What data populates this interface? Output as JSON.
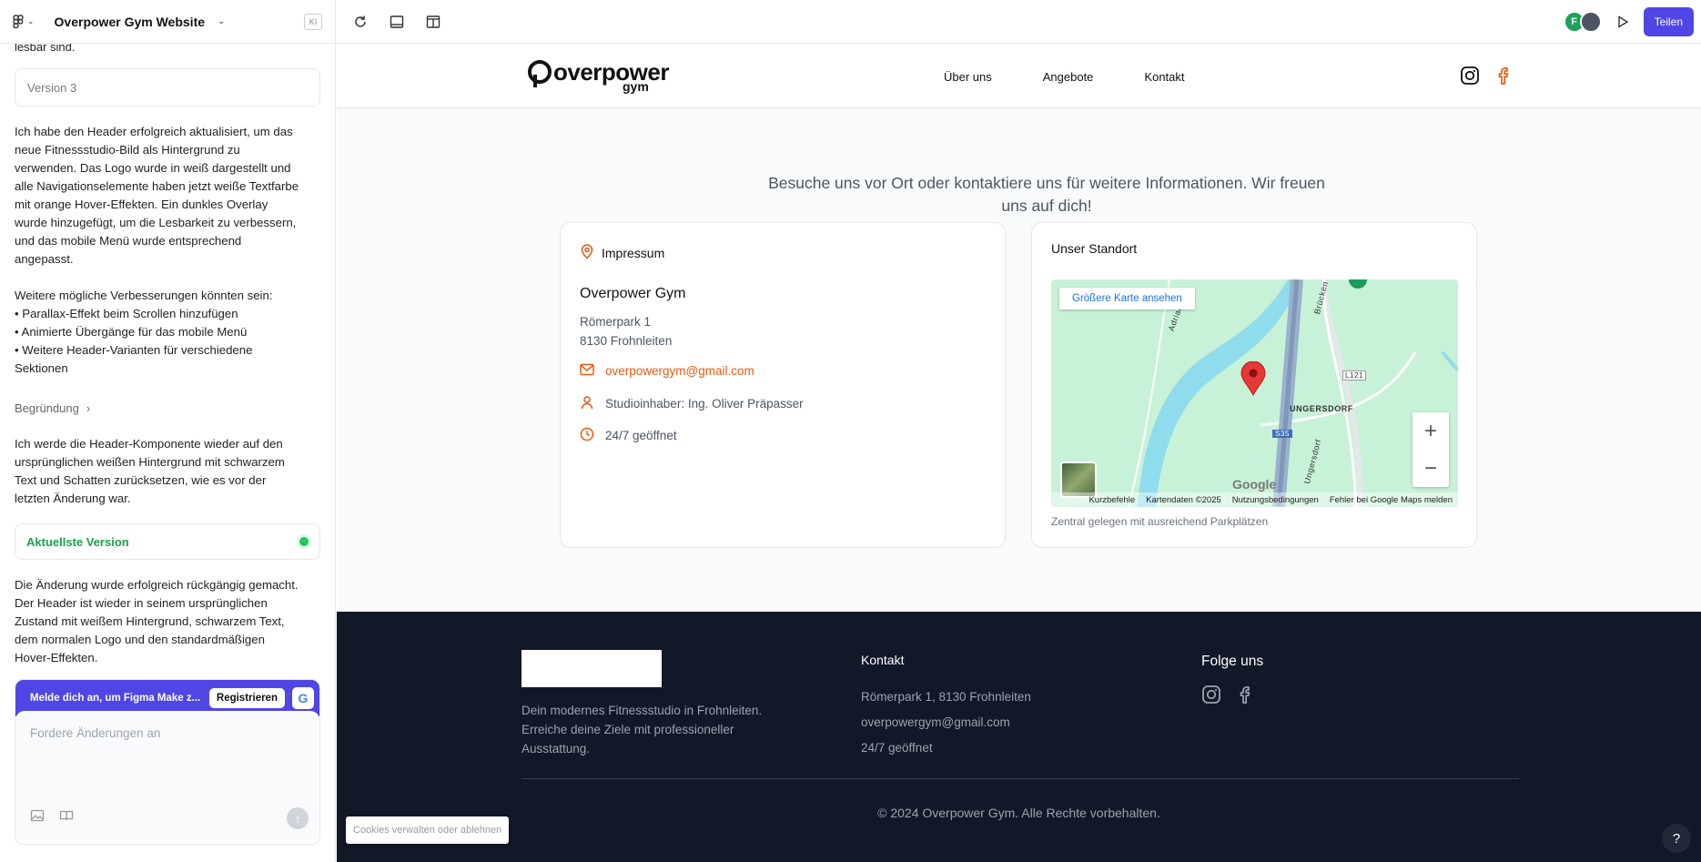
{
  "app": {
    "project_title": "Overpower Gym Website",
    "kbadge": "KI",
    "share_label": "Teilen",
    "avatar_initial": "F",
    "accent": "#4f46e5"
  },
  "chat": {
    "cut_text": "lesbar sind.",
    "version_box": "Version 3",
    "message1": "Ich habe den Header erfolgreich aktualisiert, um das\nneue Fitnessstudio-Bild als Hintergrund zu\nverwenden. Das Logo wurde in weiß dargestellt und\nalle Navigationselemente haben jetzt weiße Textfarbe\nmit orange Hover-Effekten. Ein dunkles Overlay\nwurde hinzugefügt, um die Lesbarkeit zu verbessern,\nund das mobile Menü wurde entsprechend\nangepasst.",
    "message2": "Weitere mögliche Verbesserungen könnten sein:\n• Parallax-Effekt beim Scrollen hinzufügen\n• Animierte Übergänge für das mobile Menü\n• Weitere Header-Varianten für verschiedene\nSektionen",
    "reason_label": "Begründung",
    "message3": "Ich werde die Header-Komponente wieder auf den\nursprünglichen weißen Hintergrund mit schwarzem\nText und Schatten zurücksetzen, wie es vor der\nletzten Änderung war.",
    "current_version": "Aktuellste Version",
    "message4": "Die Änderung wurde erfolgreich rückgängig gemacht.\nDer Header ist wieder in seinem ursprünglichen\nZustand mit weißem Hintergrund, schwarzem Text,\ndem normalen Logo und den standardmäßigen\nHover-Effekten.",
    "login_prompt": "Melde dich an, um Figma Make z...",
    "register_label": "Registrieren",
    "google_letter": "G",
    "input_placeholder": "Fordere Änderungen an"
  },
  "site": {
    "logo_word": "overpower",
    "logo_sub": "gym",
    "nav": [
      "Über uns",
      "Angebote",
      "Kontakt"
    ],
    "tagline": "Besuche uns vor Ort oder kontaktiere uns für weitere Informationen. Wir freuen uns auf dich!",
    "impressum": {
      "heading": "Impressum",
      "name": "Overpower Gym",
      "street": "Römerpark 1",
      "city": "8130 Frohnleiten",
      "email": "overpowergym@gmail.com",
      "owner": "Studioinhaber: Ing. Oliver Präpasser",
      "hours": "24/7 geöffnet"
    },
    "location": {
      "heading": "Unser Standort",
      "map_button": "Größere Karte ansehen",
      "caption": "Zentral gelegen mit ausreichend Parkplätzen",
      "map_labels": {
        "district": "UNGERSDORF",
        "road1": "L121",
        "road2": "S35",
        "street": "Ungersdorf",
        "bridge": "Brücken",
        "river": "Adriach"
      },
      "map_footer": [
        "Kurzbefehle",
        "Kartendaten ©2025",
        "Nutzungsbedingungen",
        "Fehler bei Google Maps melden"
      ],
      "google": "Google",
      "zoom_in": "+",
      "zoom_out": "−"
    },
    "footer": {
      "description": "Dein modernes Fitnessstudio in Frohnleiten. Erreiche deine Ziele mit professioneller Ausstattung.",
      "contact_heading": "Kontakt",
      "address": "Römerpark 1, 8130 Frohnleiten",
      "email": "overpowergym@gmail.com",
      "hours": "24/7 geöffnet",
      "follow_heading": "Folge uns",
      "copyright": "© 2024 Overpower Gym. Alle Rechte vorbehalten."
    },
    "cookie_label": "Cookies verwalten oder ablehnen",
    "help_label": "?",
    "brand_color": "#ea580c"
  }
}
